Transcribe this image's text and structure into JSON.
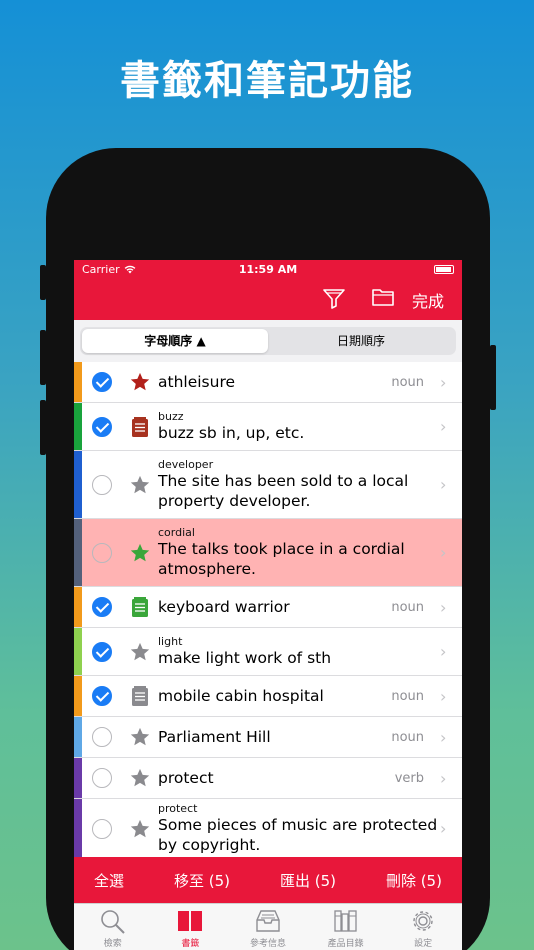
{
  "headline": "書籤和筆記功能",
  "status": {
    "carrier": "Carrier",
    "time": "11:59 AM"
  },
  "nav": {
    "done_label": "完成",
    "filter_icon": "filter-icon",
    "folder_icon": "folder-icon"
  },
  "segments": [
    {
      "label": "字母順序 ▲",
      "active": true
    },
    {
      "label": "日期順序",
      "active": false
    }
  ],
  "rows": [
    {
      "small": "",
      "main": "athleisure",
      "pos": "noun",
      "checked": true,
      "icon": "star-icon",
      "icon_color": "#b2201a",
      "bar_color": "#f29a1b",
      "highlight": false
    },
    {
      "small": "buzz",
      "main": "buzz sb in, up, etc.",
      "pos": "",
      "checked": true,
      "icon": "note-icon",
      "icon_color": "#a7321f",
      "bar_color": "#19a33c",
      "highlight": false
    },
    {
      "small": "developer",
      "main": "The site has been sold to a local property developer.",
      "pos": "",
      "checked": false,
      "icon": "star-icon",
      "icon_color": "#8a8a8e",
      "bar_color": "#1f5fd0",
      "highlight": false
    },
    {
      "small": "cordial",
      "main": "The talks took place in a cordial atmosphere.",
      "pos": "",
      "checked": false,
      "icon": "star-icon",
      "icon_color": "#3aa63a",
      "bar_color": "#53607a",
      "highlight": true
    },
    {
      "small": "",
      "main": "keyboard warrior",
      "pos": "noun",
      "checked": true,
      "icon": "note-icon",
      "icon_color": "#3aa63a",
      "bar_color": "#f29a1b",
      "highlight": false
    },
    {
      "small": "light",
      "main": "make light work of sth",
      "pos": "",
      "checked": true,
      "icon": "star-icon",
      "icon_color": "#8a8a8e",
      "bar_color": "#8fd14f",
      "highlight": false
    },
    {
      "small": "",
      "main": "mobile cabin hospital",
      "pos": "noun",
      "checked": true,
      "icon": "note-icon",
      "icon_color": "#8a8a8e",
      "bar_color": "#f29a1b",
      "highlight": false
    },
    {
      "small": "",
      "main": "Parliament Hill",
      "pos": "noun",
      "checked": false,
      "icon": "star-icon",
      "icon_color": "#8a8a8e",
      "bar_color": "#5fa8e6",
      "highlight": false
    },
    {
      "small": "",
      "main": "protect",
      "pos": "verb",
      "checked": false,
      "icon": "star-icon",
      "icon_color": "#8a8a8e",
      "bar_color": "#6a3aa8",
      "highlight": false
    },
    {
      "small": "protect",
      "main": "Some pieces of music are protected by copyright.",
      "pos": "",
      "checked": false,
      "icon": "star-icon",
      "icon_color": "#8a8a8e",
      "bar_color": "#6a3aa8",
      "highlight": false
    }
  ],
  "actions": {
    "select_all": "全選",
    "move": "移至 (5)",
    "export": "匯出 (5)",
    "delete": "刪除 (5)"
  },
  "tabs": [
    {
      "label": "檢索",
      "icon": "search-icon",
      "active": false
    },
    {
      "label": "書籤",
      "icon": "bookmark-book-icon",
      "active": true
    },
    {
      "label": "參考信息",
      "icon": "inbox-icon",
      "active": false
    },
    {
      "label": "產品目錄",
      "icon": "books-icon",
      "active": false
    },
    {
      "label": "設定",
      "icon": "gear-icon",
      "active": false
    }
  ],
  "colors": {
    "accent": "#e8173a",
    "check_blue": "#1a7cf5"
  }
}
